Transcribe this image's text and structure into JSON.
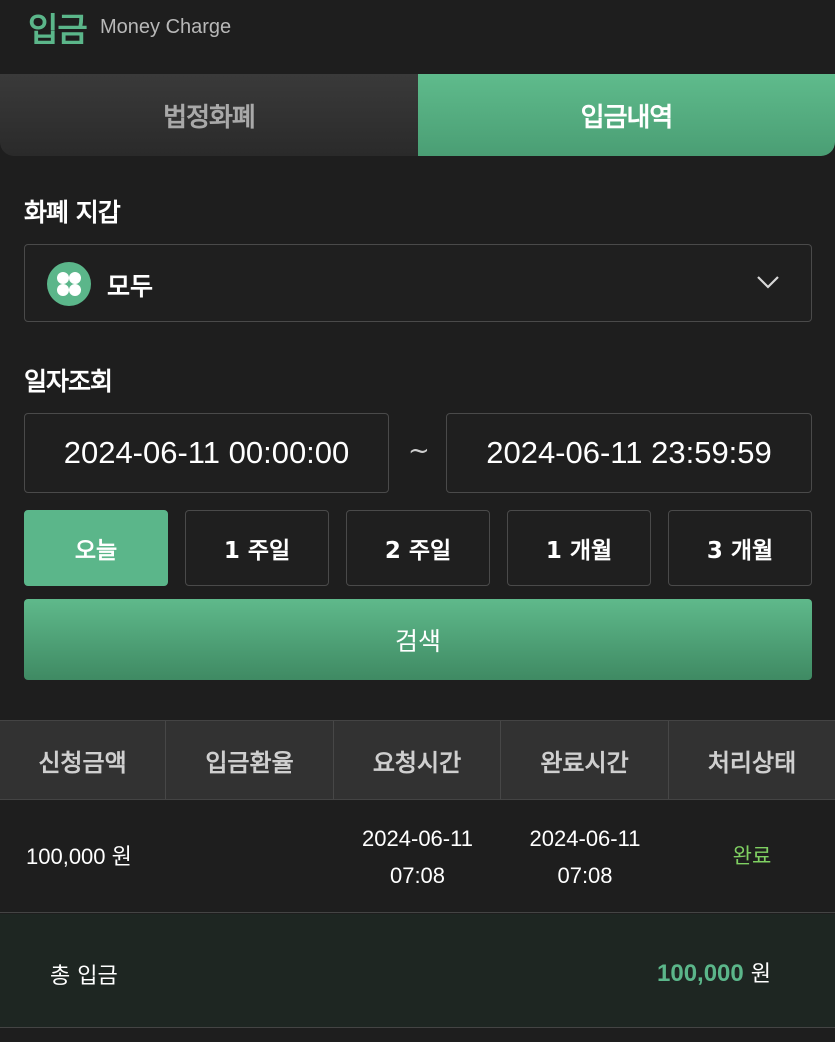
{
  "header": {
    "title": "입금",
    "subtitle": "Money Charge"
  },
  "tabs": [
    {
      "label": "법정화폐",
      "active": false
    },
    {
      "label": "입금내역",
      "active": true
    }
  ],
  "wallet": {
    "label": "화폐 지갑",
    "selected": "모두",
    "icon": "grid-icon"
  },
  "date_query": {
    "label": "일자조회",
    "start": "2024-06-11 00:00:00",
    "separator": "~",
    "end": "2024-06-11 23:59:59"
  },
  "periods": [
    {
      "label": "오늘",
      "active": true
    },
    {
      "label": "1 주일",
      "active": false
    },
    {
      "label": "2 주일",
      "active": false
    },
    {
      "label": "1 개월",
      "active": false
    },
    {
      "label": "3 개월",
      "active": false
    }
  ],
  "search_label": "검색",
  "table": {
    "headers": [
      "신청금액",
      "입금환율",
      "요청시간",
      "완료시간",
      "처리상태"
    ],
    "rows": [
      {
        "amount": "100,000 원",
        "rate": "",
        "request_date": "2024-06-11",
        "request_time": "07:08",
        "complete_date": "2024-06-11",
        "complete_time": "07:08",
        "status": "완료"
      }
    ]
  },
  "total": {
    "label": "총 입금",
    "amount": "100,000",
    "unit": " 원"
  },
  "colors": {
    "accent": "#5bb68a",
    "status_done": "#7fd062",
    "background": "#1e1e1e"
  }
}
